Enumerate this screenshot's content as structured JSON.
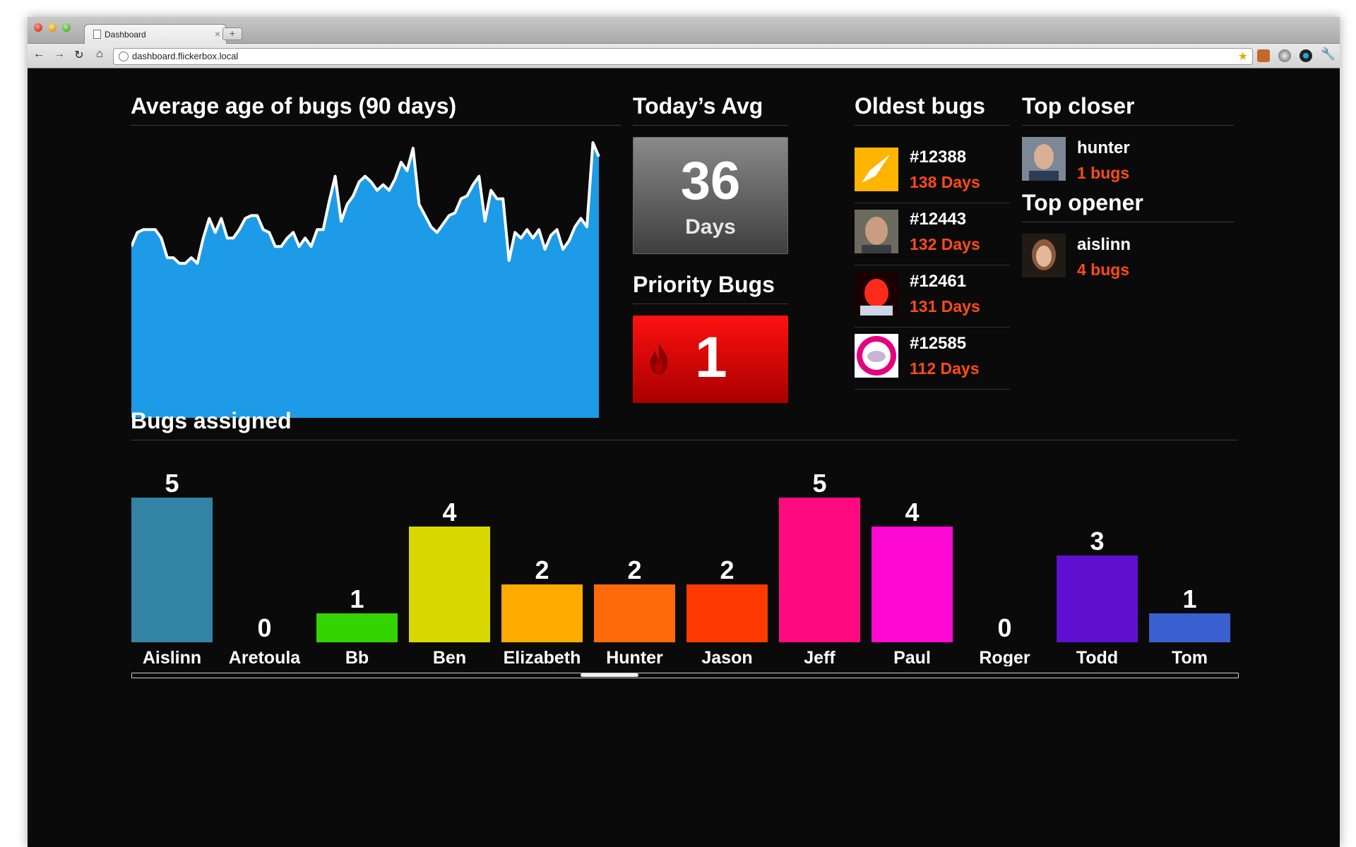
{
  "browser": {
    "tab_title": "Dashboard",
    "tab_close": "×",
    "new_tab": "+",
    "url": "dashboard.flickerbox.local",
    "icons": [
      "back-icon",
      "forward-icon",
      "reload-icon",
      "home-icon",
      "star-icon",
      "wrench-icon"
    ]
  },
  "dashboard": {
    "avg_age": {
      "title": "Average age of bugs (90 days)"
    },
    "todays_avg": {
      "title": "Today’s Avg",
      "value": "36",
      "unit": "Days"
    },
    "priority": {
      "title": "Priority Bugs",
      "value": "1",
      "icon": "flame-icon",
      "color": "#ff0000"
    },
    "oldest": {
      "title": "Oldest bugs",
      "items": [
        {
          "id": "#12388",
          "days": "138 Days"
        },
        {
          "id": "#12443",
          "days": "132 Days"
        },
        {
          "id": "#12461",
          "days": "131 Days"
        },
        {
          "id": "#12585",
          "days": "112 Days"
        }
      ]
    },
    "top_closer": {
      "title": "Top closer",
      "name": "hunter",
      "count": "1 bugs"
    },
    "top_opener": {
      "title": "Top opener",
      "name": "aislinn",
      "count": "4 bugs"
    },
    "bugs_assigned": {
      "title": "Bugs assigned"
    },
    "accent_color": "#ff4a1c"
  },
  "chart_data": [
    {
      "type": "area",
      "title": "Average age of bugs (90 days)",
      "color": "#1e9be6",
      "ylim": [
        0,
        100
      ],
      "values": [
        61,
        66,
        67,
        67,
        67,
        64,
        57,
        57,
        55,
        55,
        57,
        55,
        64,
        71,
        66,
        71,
        64,
        64,
        67,
        71,
        72,
        72,
        67,
        66,
        61,
        61,
        64,
        66,
        61,
        64,
        61,
        67,
        67,
        77,
        86,
        70,
        76,
        79,
        84,
        86,
        84,
        81,
        83,
        81,
        85,
        91,
        88,
        96,
        76,
        72,
        68,
        66,
        69,
        72,
        73,
        78,
        79,
        83,
        86,
        70,
        81,
        78,
        78,
        56,
        66,
        64,
        67,
        64,
        67,
        60,
        65,
        67,
        60,
        63,
        68,
        71,
        68,
        98,
        93
      ]
    },
    {
      "type": "bar",
      "title": "Bugs assigned",
      "categories": [
        "Aislinn",
        "Aretoula",
        "Bb",
        "Ben",
        "Elizabeth",
        "Hunter",
        "Jason",
        "Jeff",
        "Paul",
        "Roger",
        "Todd",
        "Tom"
      ],
      "values": [
        5,
        0,
        1,
        4,
        2,
        2,
        2,
        5,
        4,
        0,
        3,
        1
      ],
      "colors": [
        "#3384a4",
        "#555555",
        "#33d400",
        "#d8d800",
        "#ffaa00",
        "#ff6a0a",
        "#ff3a00",
        "#ff0a80",
        "#ff0ad4",
        "#555555",
        "#6010d0",
        "#3a5fcf"
      ]
    }
  ]
}
